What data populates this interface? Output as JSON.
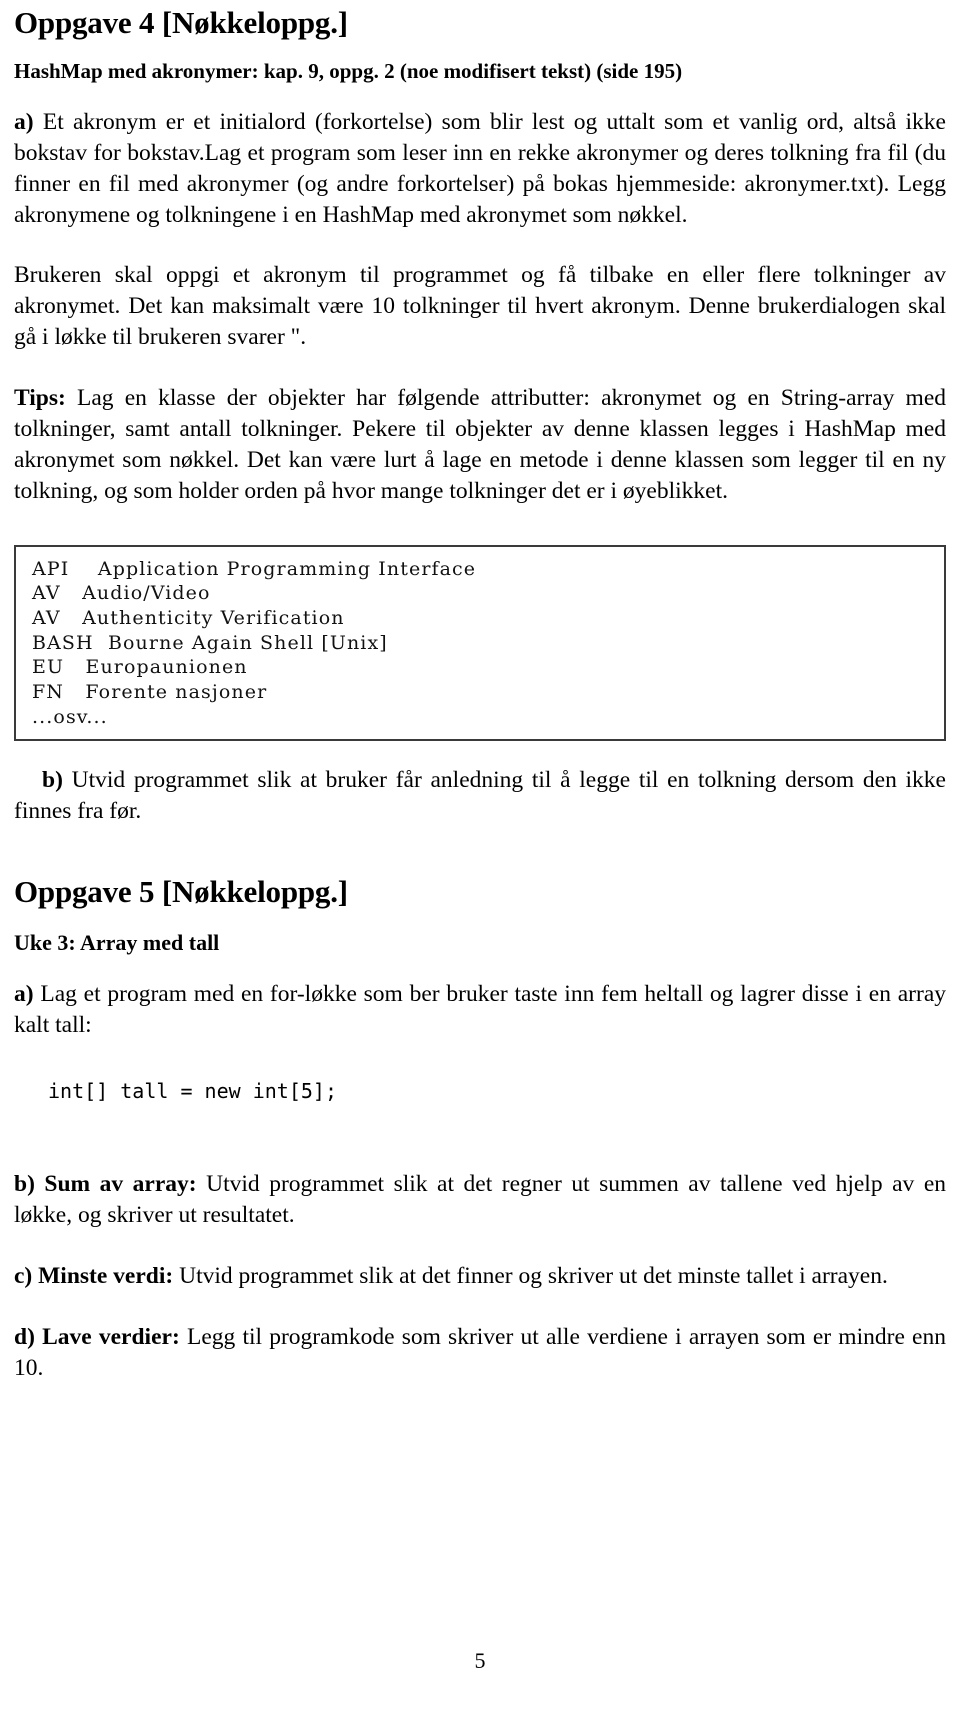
{
  "document": {
    "page_number": "5"
  },
  "task4": {
    "heading": "Oppgave 4 [Nøkkeloppg.]",
    "subheading": "HashMap med akronymer: kap. 9, oppg. 2 (noe modifisert tekst) (side 195)",
    "part_a": {
      "label": "a)",
      "text": " Et akronym er et initialord (forkortelse) som blir lest og uttalt som et vanlig ord, altså ikke bokstav for bokstav.Lag et program som leser inn en rekke akronymer og deres tolkning fra fil (du finner en fil med akronymer (og andre forkortelser) på bokas hjemmeside: akronymer.txt). Legg akronymene og tolkningene i en HashMap med akronymet som nøkkel."
    },
    "paragraph_dialog": "Brukeren skal oppgi et akronym til programmet og få tilbake en eller flere tolkninger av akronymet. Det kan maksimalt være 10 tolkninger til hvert akronym. Denne brukerdialogen skal gå i løkke til brukeren svarer \".",
    "tips": {
      "label": "Tips:",
      "text": " Lag en klasse der objekter har følgende attributter: akronymet og en String-array med tolkninger, samt antall tolkninger. Pekere til objekter av denne klassen legges i HashMap med akronymet som nøkkel. Det kan være lurt å lage en metode i denne klassen som legger til en ny tolkning, og som holder orden på hvor mange tolkninger det er i øyeblikket."
    },
    "acronym_listing": {
      "lines": [
        "API    Application Programming Interface",
        "AV   Audio/Video",
        "AV   Authenticity Verification",
        "BASH  Bourne Again Shell [Unix]",
        "EU   Europaunionen",
        "FN   Forente nasjoner",
        "...osv..."
      ]
    },
    "part_b": {
      "label": "b)",
      "text": " Utvid programmet slik at bruker får anledning til å legge til en tolkning dersom den ikke finnes fra før."
    }
  },
  "task5": {
    "heading": "Oppgave 5 [Nøkkeloppg.]",
    "subheading": "Uke 3: Array med tall",
    "part_a": {
      "label": "a)",
      "text": " Lag et program med en for-løkke som ber bruker taste inn fem heltall og lagrer disse i en array kalt tall:"
    },
    "code": "int[] tall = new int[5];",
    "part_b": {
      "label": "b) Sum av array:",
      "text": " Utvid programmet slik at det regner ut summen av tallene ved hjelp av en løkke, og skriver ut resultatet."
    },
    "part_c": {
      "label": "c) Minste verdi:",
      "text": " Utvid programmet slik at det finner og skriver ut det minste tallet i arrayen."
    },
    "part_d": {
      "label": "d) Lave verdier:",
      "text": " Legg til programkode som skriver ut alle verdiene i arrayen som er mindre enn 10."
    }
  }
}
